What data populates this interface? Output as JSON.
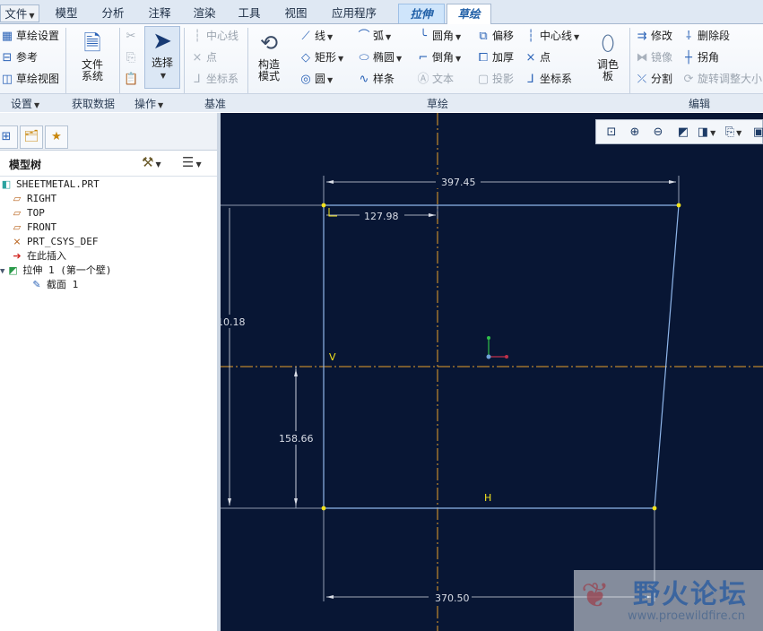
{
  "tabs": [
    {
      "label": "文件",
      "kind": "file"
    },
    {
      "label": "模型"
    },
    {
      "label": "分析"
    },
    {
      "label": "注释"
    },
    {
      "label": "渲染"
    },
    {
      "label": "工具"
    },
    {
      "label": "视图"
    },
    {
      "label": "应用程序"
    },
    {
      "label": "拉伸",
      "kind": "ctx"
    },
    {
      "label": "草绘",
      "kind": "active"
    }
  ],
  "ribbon": {
    "setup": {
      "sketch_setup": "草绘设置",
      "reference": "参考",
      "sketch_view": "草绘视图",
      "label": "设置"
    },
    "get_data": {
      "file_system": "文件\n系统",
      "label": "获取数据"
    },
    "operations": {
      "select": "选择",
      "label": "操作"
    },
    "datum": {
      "centerline": "中心线",
      "point": "点",
      "csys": "坐标系",
      "label": "基准"
    },
    "construction_mode": "构造\n模式",
    "sketch": {
      "line": "线",
      "rectangle": "矩形",
      "circle": "圆",
      "arc": "弧",
      "ellipse": "椭圆",
      "spline": "样条",
      "fillet": "圆角",
      "chamfer": "倒角",
      "text": "文本",
      "offset": "偏移",
      "thicken": "加厚",
      "project": "投影",
      "centerline": "中心线",
      "point": "点",
      "csys": "坐标系",
      "palette": "调色\n板",
      "label": "草绘"
    },
    "edit": {
      "modify": "修改",
      "delete_segment": "删除段",
      "mirror": "镜像",
      "corner": "拐角",
      "divide": "分割",
      "rotate_resize": "旋转调整大小",
      "label": "编辑"
    }
  },
  "model_tree": {
    "title": "模型树",
    "items": [
      {
        "label": "SHEETMETAL.PRT",
        "icon": "part-icon",
        "level": 0
      },
      {
        "label": "RIGHT",
        "icon": "datum-plane-icon",
        "level": 1
      },
      {
        "label": "TOP",
        "icon": "datum-plane-icon",
        "level": 1
      },
      {
        "label": "FRONT",
        "icon": "datum-plane-icon",
        "level": 1
      },
      {
        "label": "PRT_CSYS_DEF",
        "icon": "csys-icon",
        "level": 1
      },
      {
        "label": "在此插入",
        "icon": "insert-here-icon",
        "level": 1
      },
      {
        "label": "拉伸 1 (第一个壁)",
        "icon": "extrude-icon",
        "level": 1
      },
      {
        "label": "截面 1",
        "icon": "section-icon",
        "level": 2
      }
    ]
  },
  "sketch": {
    "dims": {
      "top_width": "397.45",
      "top_offset": "127.98",
      "left_height": "10.18",
      "lower_height": "158.66",
      "bottom_width": "370.50"
    },
    "labels": {
      "vertical": "V",
      "horizontal": "H"
    }
  },
  "watermark": {
    "title": "野火论坛",
    "url": "www.proewildfire.cn"
  },
  "colors": {
    "canvas_bg": "#081634",
    "sketch_line": "#8fb6ea",
    "centerline": "#e7a02a",
    "vertex": "#f2e21c",
    "dimension": "#d9dde6"
  }
}
